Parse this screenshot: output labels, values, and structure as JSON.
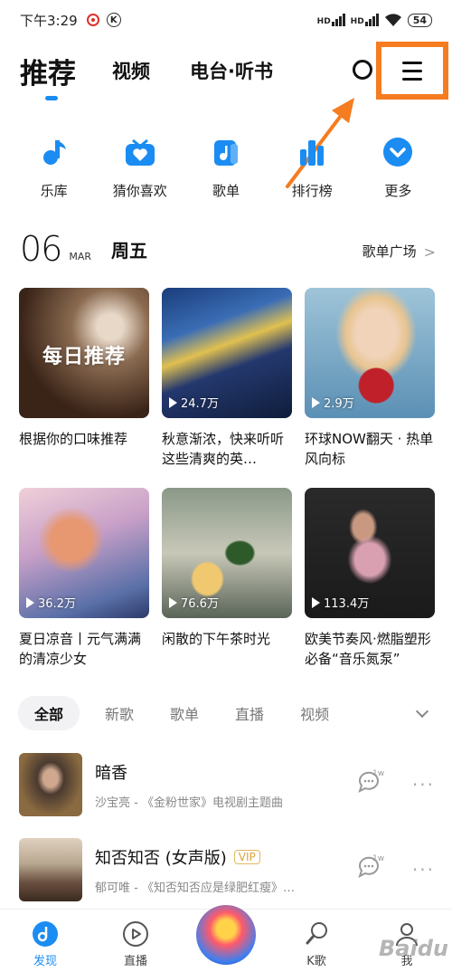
{
  "status_bar": {
    "time": "下午3:29",
    "battery": "54",
    "signal1": "HD",
    "signal2": "HD"
  },
  "top_nav": {
    "tabs": [
      {
        "label": "推荐"
      },
      {
        "label": "视频"
      },
      {
        "label": "电台·听书"
      }
    ]
  },
  "quick_icons": [
    {
      "label": "乐库",
      "icon": "music-note-icon"
    },
    {
      "label": "猜你喜欢",
      "icon": "heart-radio-icon"
    },
    {
      "label": "歌单",
      "icon": "playlist-icon"
    },
    {
      "label": "排行榜",
      "icon": "chart-bars-icon"
    },
    {
      "label": "更多",
      "icon": "chevron-down-circle-icon"
    }
  ],
  "date_header": {
    "day": "06",
    "month": "MAR",
    "weekday": "周五",
    "plaza": "歌单广场"
  },
  "cards": [
    {
      "caption": "根据你的口味推荐",
      "overlay": "每日推荐",
      "plays": ""
    },
    {
      "caption": "秋意渐浓，快来听听这些清爽的英…",
      "plays": "24.7万"
    },
    {
      "caption": "环球NOW翻天 · 热单风向标",
      "plays": "2.9万"
    },
    {
      "caption": "夏日凉音丨元气满满的清凉少女",
      "plays": "36.2万"
    },
    {
      "caption": "闲散的下午茶时光",
      "plays": "76.6万"
    },
    {
      "caption": "欧美节奏风·燃脂塑形必备“音乐氮泵”",
      "plays": "113.4万"
    }
  ],
  "filters": [
    {
      "label": "全部"
    },
    {
      "label": "新歌"
    },
    {
      "label": "歌单"
    },
    {
      "label": "直播"
    },
    {
      "label": "视频"
    }
  ],
  "songs": [
    {
      "title": "暗香",
      "sub": "沙宝亮 - 《金粉世家》电视剧主题曲",
      "comments": "1w",
      "vip": ""
    },
    {
      "title": "知否知否 (女声版)",
      "sub": "郁可唯 - 《知否知否应是绿肥红瘦》…",
      "comments": "1w",
      "vip": "VIP"
    }
  ],
  "bottom_nav": [
    {
      "label": "发现"
    },
    {
      "label": "直播"
    },
    {
      "label": ""
    },
    {
      "label": "K歌"
    },
    {
      "label": "我"
    }
  ],
  "colors": {
    "accent": "#1b8cf2",
    "highlight": "#f57c1f"
  },
  "watermark": "Baidu"
}
